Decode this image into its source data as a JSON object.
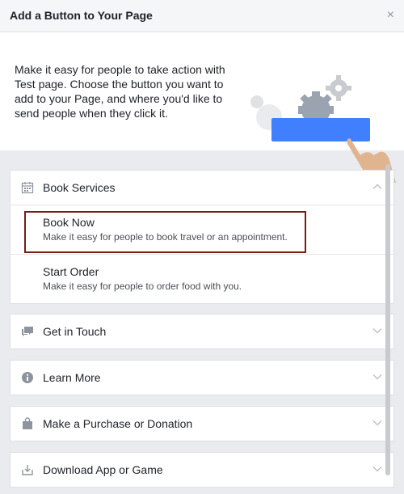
{
  "dialog": {
    "title": "Add a Button to Your Page",
    "close_label": "×"
  },
  "intro": {
    "text": "Make it easy for people to take action with Test page. Choose the button you want to add to your Page, and where you'd like to send people when they click it."
  },
  "sections": [
    {
      "label": "Book Services",
      "icon": "calendar-icon",
      "expanded": true,
      "options": [
        {
          "title": "Book Now",
          "description": "Make it easy for people to book travel or an appointment.",
          "selected": true
        },
        {
          "title": "Start Order",
          "description": "Make it easy for people to order food with you.",
          "selected": false
        }
      ]
    },
    {
      "label": "Get in Touch",
      "icon": "chat-bubbles-icon",
      "expanded": false
    },
    {
      "label": "Learn More",
      "icon": "info-icon",
      "expanded": false
    },
    {
      "label": "Make a Purchase or Donation",
      "icon": "shopping-bag-icon",
      "expanded": false
    },
    {
      "label": "Download App or Game",
      "icon": "download-icon",
      "expanded": false
    }
  ],
  "colors": {
    "accent": "#4080ff",
    "highlight_border": "#7a1a1a"
  }
}
